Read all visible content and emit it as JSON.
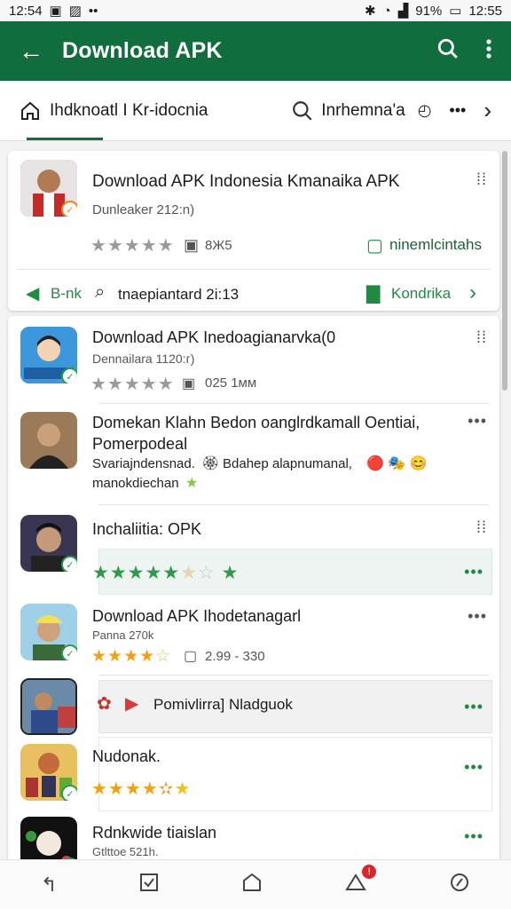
{
  "status": {
    "time_left": "12:54",
    "battery": "91%",
    "time_right": "12:55"
  },
  "appbar": {
    "title": "Download APK"
  },
  "tabs": {
    "home_label": "Ihdknoatl I Kr-idocnia",
    "search_label": "Inrhemna'a"
  },
  "featured": {
    "title": "Download APK Indonesia Kmanaika APK",
    "sub": "Dunleaker 212:n)",
    "size": "8Ж5",
    "link": "ninemlcintahs",
    "foot_left": "B-nk",
    "foot_mid": "tnaepiantard 2i:13",
    "foot_right": "Kondrika"
  },
  "items": [
    {
      "title": "Download APK Inedoagianarvka(0",
      "sub": "Dennailara 1120:г)",
      "meta": "025  1мм"
    },
    {
      "title": "Domekan Klahn Bedon oanglrdkamall Oentiai,",
      "title2": "Pomerpodeal",
      "sub": "Svariajndensnad.",
      "sub_b": "Bdahep alapnumanal,",
      "sub2": "manokdiechan"
    },
    {
      "title": "Inchaliitia: OPK"
    },
    {
      "title": "Download APK Ihodetanagarl",
      "sub": "Panna 270k",
      "meta": "2.99 - 330"
    },
    {
      "title": "Pomivlirra] Nladguok"
    },
    {
      "title": "Nudonak."
    },
    {
      "title": "Rdnkwide tiaislan",
      "sub": "Gtlttoe 521h."
    }
  ],
  "colors": {
    "brand": "#126d3e",
    "accent": "#1f8a44",
    "star_gold": "#f3a112"
  },
  "nav": {
    "icons": [
      "back-icon",
      "recent-apps-icon",
      "home-icon",
      "notifications-icon",
      "compass-icon"
    ],
    "badge": "!"
  }
}
